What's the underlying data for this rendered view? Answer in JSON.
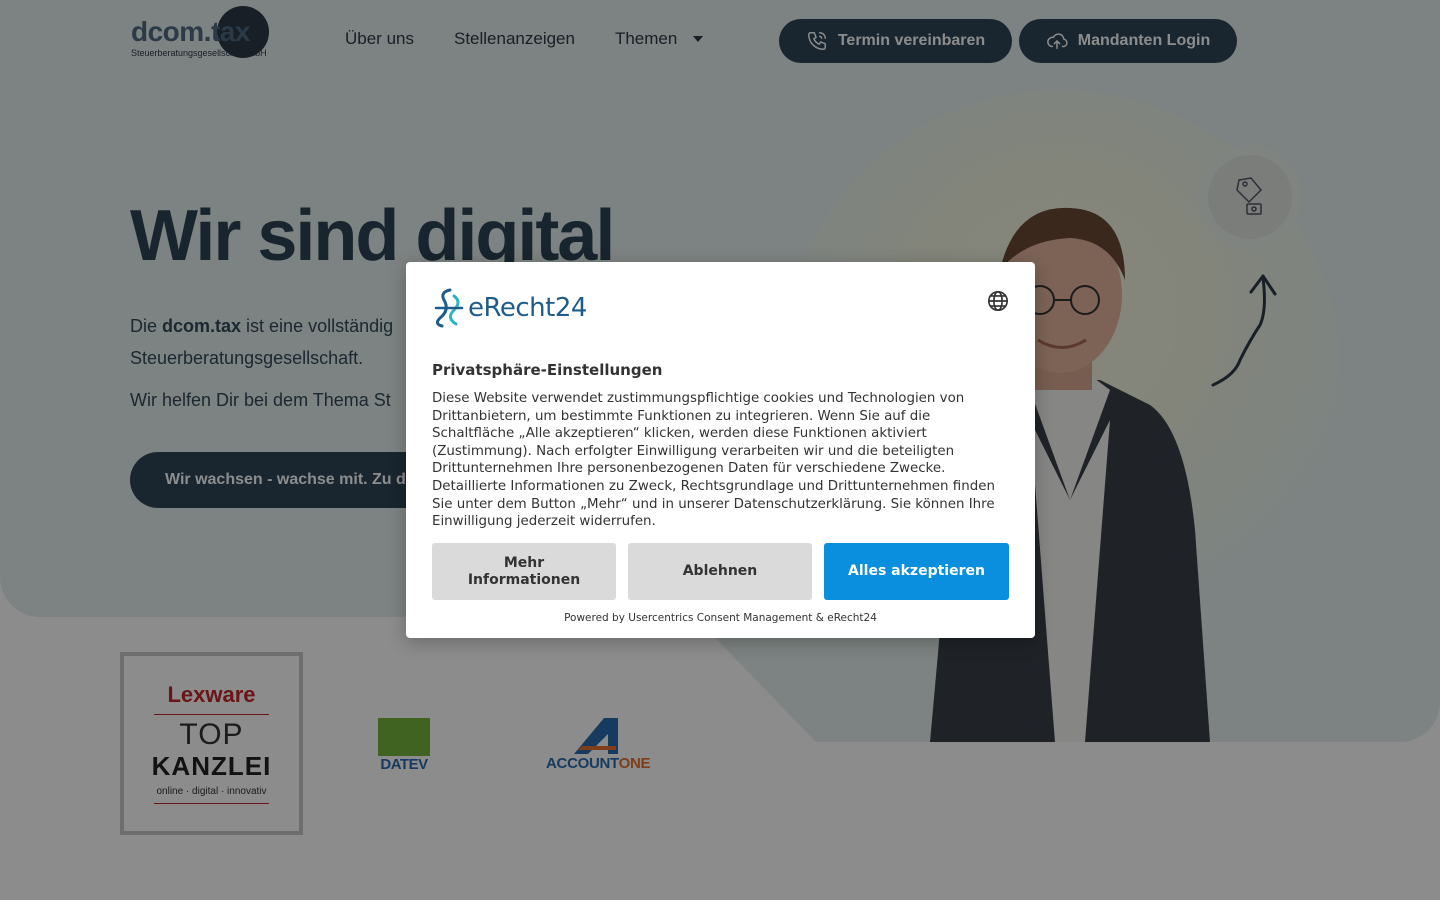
{
  "header": {
    "logo_text": "dcom.tax",
    "logo_subtitle": "Steuerberatungsgesellschaft mbH",
    "nav": [
      {
        "label": "Über uns"
      },
      {
        "label": "Stellenanzeigen"
      },
      {
        "label": "Themen",
        "has_dropdown": true
      }
    ],
    "termin_button": "Termin vereinbaren",
    "login_button": "Mandanten Login"
  },
  "hero": {
    "title": "Wir sind digital",
    "p1_prefix": "Die ",
    "p1_brand": "dcom.tax",
    "p1_rest": " ist eine vollständig",
    "p1_line2": "Steuerberatungsgesellschaft.",
    "p2": "Wir helfen Dir bei dem Thema St",
    "cta": "Wir wachsen - wachse mit. Zu d"
  },
  "partners": {
    "lexware": {
      "brand": "Lexware",
      "line1": "TOP",
      "line2": "KANZLEI",
      "tagline": "online · digital · innovativ"
    },
    "datev": "DATEV",
    "accountone_a": "ACCOUNT",
    "accountone_b": "ONE"
  },
  "consent": {
    "logo_text": "eRecht24",
    "title": "Privatsphäre-Einstellungen",
    "body": "Diese Website verwendet zustimmungspflichtige cookies und Technologien von Drittanbietern, um bestimmte Funktionen zu integrieren. Wenn Sie auf die Schaltfläche „Alle akzeptieren“ klicken, werden diese Funktionen aktiviert (Zustimmung). Nach erfolgter Einwilligung verarbeiten wir und die beteiligten Drittunternehmen Ihre personenbezogenen Daten für verschiedene Zwecke. Detaillierte Informationen zu Zweck, Rechtsgrundlage und Drittunternehmen finden Sie unter dem Button „Mehr“ und in unserer Datenschutzerklärung. Sie können Ihre Einwilligung jederzeit widerrufen.",
    "btn_more": "Mehr Informationen",
    "btn_deny": "Ablehnen",
    "btn_accept": "Alles akzeptieren",
    "powered_by": "Powered by Usercentrics Consent Management & eRecht24"
  },
  "colors": {
    "hero_bg": "#e3efed",
    "primary_dark": "#2f4656",
    "accept_blue": "#0a8ede",
    "overlay": "rgba(0,0,0,0.45)"
  },
  "icons": {
    "termin": "phone-call-icon",
    "login": "cloud-upload-icon",
    "language": "globe-icon",
    "bubble": "money-tag-icon"
  }
}
